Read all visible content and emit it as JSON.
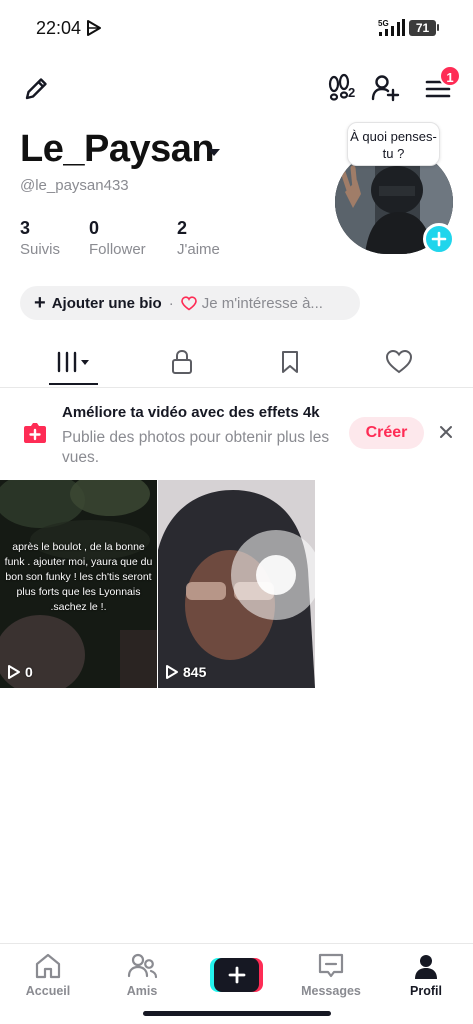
{
  "status_bar": {
    "time": "22:04",
    "network": "5G",
    "battery": "71"
  },
  "top_bar": {
    "visitors_count": "2",
    "notification_count": "1"
  },
  "profile": {
    "username": "Le_Paysan",
    "handle": "@le_paysan433",
    "stats": [
      {
        "value": "3",
        "label": "Suivis"
      },
      {
        "value": "0",
        "label": "Follower"
      },
      {
        "value": "2",
        "label": "J'aime"
      }
    ],
    "thought_bubble": "À quoi penses-tu ?"
  },
  "bio_chip": {
    "add_bio": "Ajouter une bio",
    "separator": "·",
    "interest": "Je m'intéresse à..."
  },
  "promo": {
    "title": "Améliore ta vidéo avec des effets 4k",
    "description": "Publie des photos pour obtenir plus les vues.",
    "create_label": "Créer"
  },
  "videos": [
    {
      "views": "0",
      "caption": "après le boulot , de la bonne funk . ajouter moi, yaura que du bon son funky ! les ch'tis seront plus forts que les Lyonnais .sachez le !."
    },
    {
      "views": "845"
    }
  ],
  "bottom_nav": {
    "home": "Accueil",
    "friends": "Amis",
    "messages": "Messages",
    "profile": "Profil"
  },
  "colors": {
    "accent": "#fe2c55",
    "cyan": "#20d5ec",
    "text": "#161823",
    "muted": "#8a8b91"
  }
}
